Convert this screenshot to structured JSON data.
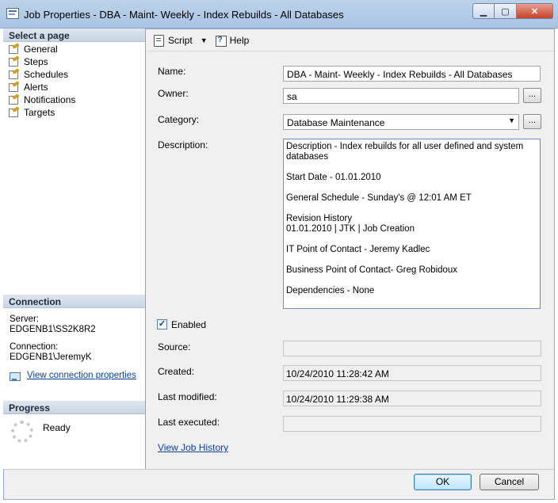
{
  "window": {
    "title": "Job Properties - DBA - Maint- Weekly - Index Rebuilds - All Databases",
    "minimize_glyph": "▁",
    "maximize_glyph": "▢",
    "close_glyph": "✕"
  },
  "sidebar": {
    "select_page_header": "Select a page",
    "pages": [
      {
        "label": "General",
        "icon": "wrench-page-icon"
      },
      {
        "label": "Steps",
        "icon": "wrench-page-icon"
      },
      {
        "label": "Schedules",
        "icon": "wrench-page-icon"
      },
      {
        "label": "Alerts",
        "icon": "wrench-page-icon"
      },
      {
        "label": "Notifications",
        "icon": "wrench-page-icon"
      },
      {
        "label": "Targets",
        "icon": "wrench-page-icon"
      }
    ],
    "connection_header": "Connection",
    "server_label": "Server:",
    "server_value": "EDGENB1\\SS2K8R2",
    "connection_label": "Connection:",
    "connection_value": "EDGENB1\\JeremyK",
    "view_connection_link": "View connection properties",
    "progress_header": "Progress",
    "progress_status": "Ready"
  },
  "toolbar": {
    "script_label": "Script",
    "help_label": "Help"
  },
  "form": {
    "name_label": "Name:",
    "name_value": "DBA - Maint- Weekly - Index Rebuilds - All Databases",
    "owner_label": "Owner:",
    "owner_value": "sa",
    "category_label": "Category:",
    "category_value": "Database Maintenance",
    "description_label": "Description:",
    "description_lines": [
      "Description - Index rebuilds for all user defined and system databases",
      "Start Date - 01.01.2010",
      "General Schedule - Sunday's @ 12:01 AM ET",
      "Revision History",
      "01.01.2010 | JTK | Job Creation",
      "IT Point of Contact - Jeremy Kadlec",
      "Business Point of Contact- Greg Robidoux",
      "Dependencies - None"
    ],
    "enabled_label": "Enabled",
    "enabled_checked": true,
    "source_label": "Source:",
    "source_value": "",
    "created_label": "Created:",
    "created_value": "10/24/2010 11:28:42 AM",
    "last_modified_label": "Last modified:",
    "last_modified_value": "10/24/2010 11:29:38 AM",
    "last_executed_label": "Last executed:",
    "last_executed_value": "",
    "view_history_link": "View Job History",
    "ellipsis": "..."
  },
  "buttons": {
    "ok": "OK",
    "cancel": "Cancel"
  }
}
